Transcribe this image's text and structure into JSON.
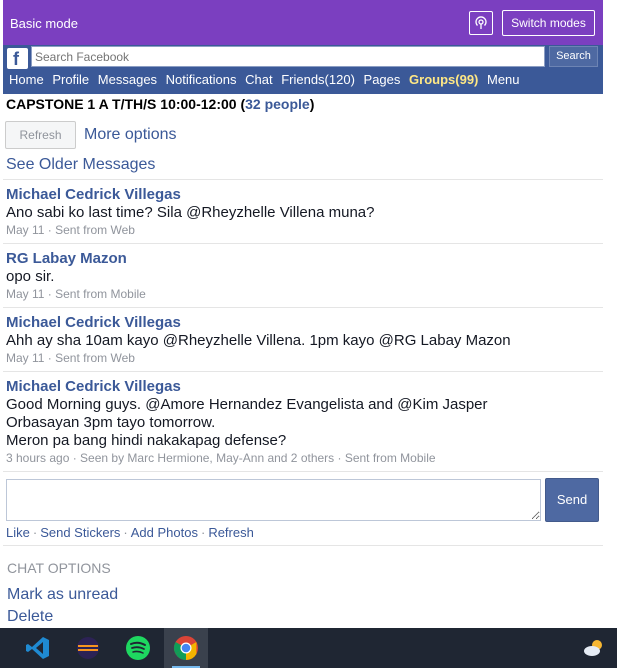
{
  "mode_bar": {
    "label": "Basic mode",
    "switch_label": "Switch modes"
  },
  "fb_bar": {
    "search_placeholder": "Search Facebook",
    "search_button": "Search",
    "nav": [
      "Home",
      "Profile",
      "Messages",
      "Notifications",
      "Chat",
      "Friends(120)",
      "Pages",
      "Groups(99)",
      "Menu"
    ]
  },
  "conversation": {
    "title": "CAPSTONE 1 A T/TH/S 10:00-12:00",
    "people_link": "32 people",
    "refresh_button": "Refresh",
    "more_options": "More options",
    "older_link": "See Older Messages"
  },
  "messages": [
    {
      "author": "Michael Cedrick Villegas",
      "lines": [
        "Ano sabi ko last time? Sila @Rheyzhelle Villena muna?"
      ],
      "meta": "May 11 · Sent from Web"
    },
    {
      "author": "RG Labay Mazon",
      "lines": [
        "opo sir."
      ],
      "meta": "May 11 · Sent from Mobile"
    },
    {
      "author": "Michael Cedrick Villegas",
      "lines": [
        "Ahh ay sha 10am kayo @Rheyzhelle Villena. 1pm kayo @RG Labay Mazon"
      ],
      "meta": "May 11 · Sent from Web"
    },
    {
      "author": "Michael Cedrick Villegas",
      "lines": [
        "Good Morning guys. @Amore Hernandez Evangelista and @Kim Jasper",
        "Orbasayan 3pm tayo tomorrow.",
        "Meron pa bang hindi nakakapag defense?"
      ],
      "meta": "3 hours ago · Seen by Marc Hermione, May-Ann and 2 others · Sent from Mobile"
    }
  ],
  "composer": {
    "send_button": "Send",
    "actions": [
      "Like",
      "Send Stickers",
      "Add Photos",
      "Refresh"
    ]
  },
  "chat_options": {
    "label": "CHAT OPTIONS",
    "mark_unread": "Mark as unread",
    "delete": "Delete"
  },
  "taskbar": {
    "apps": [
      "vscode-icon",
      "eclipse-icon",
      "spotify-icon",
      "chrome-icon"
    ],
    "active_app": "chrome-icon"
  },
  "colors": {
    "mode_bar": "#7b3fc0",
    "facebook_blue": "#3b5998",
    "groups_highlight": "#ffe885",
    "taskbar": "#1f2633"
  }
}
